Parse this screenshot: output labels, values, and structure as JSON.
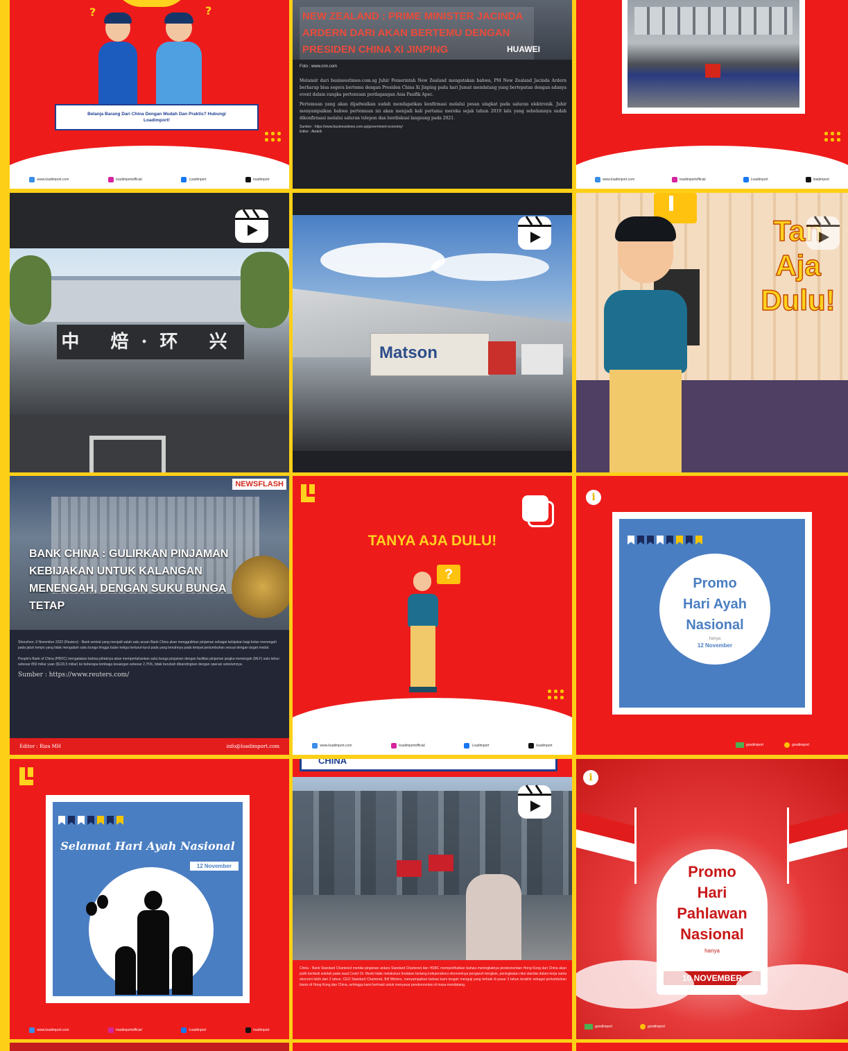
{
  "tiles": {
    "t0": {
      "banner": "Belanja Barang Dari China Dengan Mudah Dan Praktis? Hubungi Loadimport!"
    },
    "t1": {
      "headline": "NEW ZEALAND : PRIME MINISTER JACINDA ARDERN DARI AKAN BERTEMU DENGAN PRESIDEN CHINA XI JINPING",
      "watermark": "HUAWEI",
      "photo_credit": "Foto : www.cnn.com",
      "body1": "Melansir dari businesstimes.com.sg Juhir Pemerintah New Zealand mengatakan bahwa, PM New Zealand Jacinda Ardern berharap bisa segera bertemu dengan Presiden China Xi Jinping pada hari Jumat mendatang yang bertepatan dengan adanya event dalam rangka pertemuan perdagangan Asia Pasifik Apec.",
      "body2": "Pertemuan yang akan dijadwalkan sudah mendapatkan konfirmasi melalui pesan singkat pada saluran elektronik. Juhir menyampaikan bahwa pertemuan ini akan menjadi kali pertama mereka sejak tahun 2019 lalu yang sebelumnya sudah dikonfirmasi melalui saluran telepon dan berdiskusi langsung pada 2021.",
      "source": "Sumber : https://www.businesstimes.com.sg/government-economy/",
      "editor": "Editor : Abdelli"
    },
    "t4": {
      "truck": "Matson"
    },
    "t5": {
      "overlay": [
        "Tan",
        "Aja",
        "Dulu!"
      ]
    },
    "t6": {
      "badge": "NEWSFLASH",
      "headline": "BANK CHINA : GULIRKAN PINJAMAN KEBIJAKAN UNTUK KALANGAN MENENGAH, DENGAN SUKU BUNGA TETAP",
      "body1": "Shenzhen, 9 November 2022 (Reuters) - Bank sentral yang menjadi salah satu acuan Bank China akan menggulirkan pinjaman sebagai kebijakan bagi kelas menengah pada jatuh tempo yang tidak mengubah suku bunga hingga bulan ketiga berturut-turut pada yang lemahnya pada tempat pertumbuhan sesuai dengan target modal.",
      "body2": "People's Bank of China (PBOC) mengatakan bahwa pihaknya akan mempertahankan suku bunga pinjaman dengan fasilitas pinjaman jangka menengah (MLF) satu tahun sebesar 850 miliar yuan ($120,5 miliar) ke beberapa lembaga keuangan sebesar 2,75%, tidak berubah dibandingkan dengan operasi sebelumnya.",
      "source": "Sumber : https://www.reuters.com/",
      "editor": "Editor : Riza MH",
      "email": "info@loadimport.com"
    },
    "t7": {
      "title": "TANYA AJA DULU!",
      "bubble": "?"
    },
    "t8": {
      "l1": "Promo",
      "l2": "Hari Ayah",
      "l3": "Nasional",
      "small": "hanya",
      "date": "12 November",
      "info": "i"
    },
    "t9": {
      "title": "Selamat Hari Ayah Nasional",
      "date": "12 November"
    },
    "t10": {
      "top": "CHINA",
      "body": "China - Bank Standard Chartered menilai pinjaman antara Standard Chartered dan HSBC memperlihatkan bahwa meningkatnya perekonomian Hong Kong dan China akan pulih kembali setelah pada awal Covid 19. Meski tidak melakukan tindakan tentang independensi ekonominya pengaruh tiongkok, peningkatan nilai standar dalam kerja sama ekonomi lebih dari 2 tahun. CEO Standard Chartered, Bill Winters, menyampaikan bahwa kami tengah menguji yang terbaik di pasar 3 tahun terakhir sebagai pertumbuhan bisnis di Hong Kong dan China, sehingga kami berhasil untuk menyasar perekonomian di masa mendatang."
    },
    "t11": {
      "l1": "Promo",
      "l2": "Hari",
      "l3": "Pahlawan",
      "l4": "Nasional",
      "small": "hanya",
      "date": "10 NOVEMBER",
      "info": "i"
    }
  },
  "footer": {
    "web": "www.loadimport.com",
    "ig": "loadimportofficial",
    "fb": "Loadimport",
    "tt": "loadimport"
  },
  "footer2": {
    "a": "goodimport",
    "b": "goodimport"
  },
  "colors": {
    "brand_red": "#ee1b1b",
    "accent_yellow": "#fdd017",
    "promo_blue": "#4a7ec2",
    "dark": "#222"
  }
}
